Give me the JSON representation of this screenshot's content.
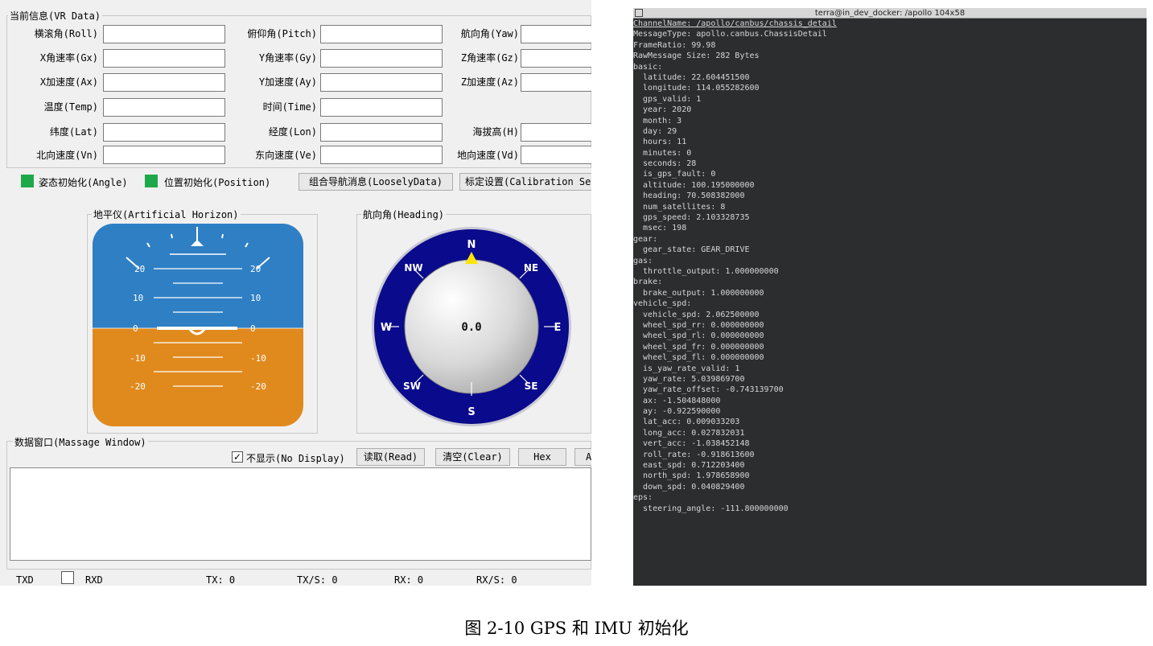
{
  "vr_group": {
    "title": "当前信息(VR Data)",
    "rows": [
      [
        {
          "label": "横滚角(Roll)",
          "value": ""
        },
        {
          "label": "俯仰角(Pitch)",
          "value": ""
        },
        {
          "label": "航向角(Yaw)",
          "value": ""
        }
      ],
      [
        {
          "label": "X角速率(Gx)",
          "value": ""
        },
        {
          "label": "Y角速率(Gy)",
          "value": ""
        },
        {
          "label": "Z角速率(Gz)",
          "value": ""
        }
      ],
      [
        {
          "label": "X加速度(Ax)",
          "value": ""
        },
        {
          "label": "Y加速度(Ay)",
          "value": ""
        },
        {
          "label": "Z加速度(Az)",
          "value": ""
        }
      ],
      [
        {
          "label": "温度(Temp)",
          "value": ""
        },
        {
          "label": "时间(Time)",
          "value": ""
        }
      ],
      [
        {
          "label": "纬度(Lat)",
          "value": ""
        },
        {
          "label": "经度(Lon)",
          "value": ""
        },
        {
          "label": "海拔高(H)",
          "value": ""
        }
      ],
      [
        {
          "label": "北向速度(Vn)",
          "value": ""
        },
        {
          "label": "东向速度(Ve)",
          "value": ""
        },
        {
          "label": "地向速度(Vd)",
          "value": ""
        }
      ]
    ]
  },
  "status_row": {
    "angle_init": "姿态初始化(Angle)",
    "position_init": "位置初始化(Position)",
    "loosely_button": "组合导航消息(LooselyData)",
    "calibration_button": "标定设置(Calibration Se",
    "indicator_color": "#1fa84a"
  },
  "horizon": {
    "title": "地平仪(Artificial Horizon)",
    "sky_color": "#2f7fc4",
    "ground_color": "#e08a1e",
    "pitch_labels": [
      "20",
      "10",
      "0",
      "-10",
      "-20"
    ],
    "pitch_labels_right": [
      "20",
      "10",
      "0",
      "-10",
      "-20"
    ]
  },
  "heading": {
    "title": "航向角(Heading)",
    "value": "0.0",
    "directions": [
      "N",
      "NE",
      "E",
      "SE",
      "S",
      "SW",
      "W",
      "NW"
    ],
    "ring_color": "#0a0a8c"
  },
  "message_window": {
    "title": "数据窗口(Massage Window)",
    "no_display": "不显示(No Display)",
    "read_button": "读取(Read)",
    "clear_button": "清空(Clear)",
    "hex_button": "Hex",
    "a_button": "A"
  },
  "bottom_status": {
    "txd": "TXD",
    "rxd": "RXD",
    "tx": "TX:  0",
    "txs": "TX/S:  0",
    "rx": "RX:  0",
    "rxs": "RX/S:  0"
  },
  "terminal": {
    "title": "terra@in_dev_docker: /apollo 104x58",
    "lines": [
      "ChannelName: /apollo/canbus/chassis_detail",
      "MessageType: apollo.canbus.ChassisDetail",
      "FrameRatio: 99.98",
      "RawMessage Size: 282 Bytes",
      "basic:",
      "  latitude: 22.604451500",
      "  longitude: 114.055282600",
      "  gps_valid: 1",
      "  year: 2020",
      "  month: 3",
      "  day: 29",
      "  hours: 11",
      "  minutes: 0",
      "  seconds: 28",
      "  is_gps_fault: 0",
      "  altitude: 100.195000000",
      "  heading: 70.508382000",
      "  num_satellites: 8",
      "  gps_speed: 2.103328735",
      "  msec: 198",
      "gear:",
      "  gear_state: GEAR_DRIVE",
      "gas:",
      "  throttle_output: 1.000000000",
      "brake:",
      "  brake_output: 1.000000000",
      "vehicle_spd:",
      "  vehicle_spd: 2.062500000",
      "  wheel_spd_rr: 0.000000000",
      "  wheel_spd_rl: 0.000000000",
      "  wheel_spd_fr: 0.000000000",
      "  wheel_spd_fl: 0.000000000",
      "  is_yaw_rate_valid: 1",
      "  yaw_rate: 5.039869700",
      "  yaw_rate_offset: -0.743139700",
      "  ax: -1.504848000",
      "  ay: -0.922590000",
      "  lat_acc: 0.009033203",
      "  long_acc: 0.027832031",
      "  vert_acc: -1.038452148",
      "  roll_rate: -0.918613600",
      "  east_spd: 0.712203400",
      "  north_spd: 1.978658900",
      "  down_spd: 0.040829400",
      "eps:",
      "  steering_angle: -111.800000000"
    ]
  },
  "caption": "图 2-10 GPS 和 IMU 初始化"
}
